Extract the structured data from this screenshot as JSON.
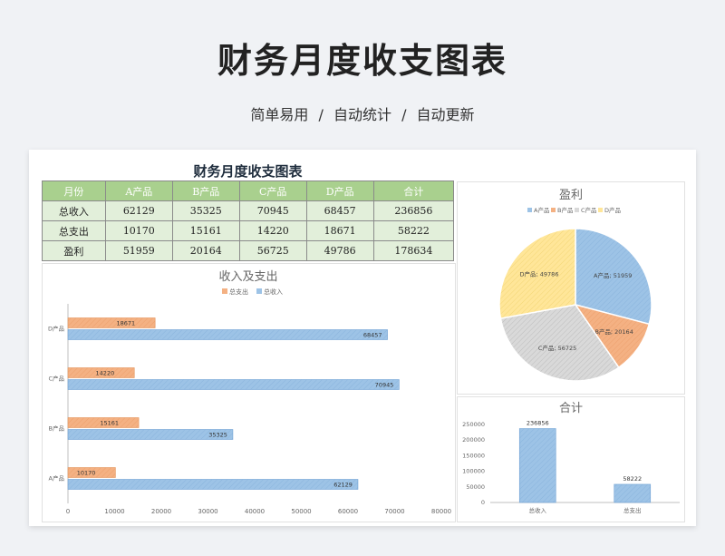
{
  "page": {
    "title": "财务月度收支图表",
    "subtitle": "简单易用   /   自动统计   /   自动更新"
  },
  "table": {
    "title": "财务月度收支图表",
    "headers": [
      "月份",
      "A产品",
      "B产品",
      "C产品",
      "D产品",
      "合计"
    ],
    "rows": [
      [
        "总收入",
        "62129",
        "35325",
        "70945",
        "68457",
        "236856"
      ],
      [
        "总支出",
        "10170",
        "15161",
        "14220",
        "18671",
        "58222"
      ],
      [
        "盈利",
        "51959",
        "20164",
        "56725",
        "49786",
        "178634"
      ]
    ]
  },
  "colors": {
    "expense": "#f4b183",
    "income": "#9dc3e6",
    "c": "#d9d9d9",
    "d": "#ffe699",
    "header": "#a9d08e",
    "row": "#e2efda"
  },
  "chart_data": [
    {
      "type": "bar",
      "orientation": "horizontal",
      "title": "收入及支出",
      "categories": [
        "A产品",
        "B产品",
        "C产品",
        "D产品"
      ],
      "series": [
        {
          "name": "总支出",
          "values": [
            10170,
            15161,
            14220,
            18671
          ]
        },
        {
          "name": "总收入",
          "values": [
            62129,
            35325,
            70945,
            68457
          ]
        }
      ],
      "xlim": [
        0,
        80000
      ],
      "xticks": [
        "0",
        "10000",
        "20000",
        "30000",
        "40000",
        "50000",
        "60000",
        "70000",
        "80000"
      ],
      "legend": "top"
    },
    {
      "type": "pie",
      "title": "盈利",
      "labels": [
        "A产品",
        "B产品",
        "C产品",
        "D产品"
      ],
      "values": [
        51959,
        20164,
        56725,
        49786
      ],
      "data_labels": [
        "A产品; 51959",
        "B产品; 20164",
        "C产品; 56725",
        "D产品; 49786"
      ],
      "legend": "top"
    },
    {
      "type": "bar",
      "title": "合计",
      "categories": [
        "总收入",
        "总支出"
      ],
      "values": [
        236856,
        58222
      ],
      "ylim": [
        0,
        250000
      ],
      "yticks": [
        "250000",
        "200000",
        "150000",
        "100000",
        "50000",
        "0"
      ]
    }
  ]
}
